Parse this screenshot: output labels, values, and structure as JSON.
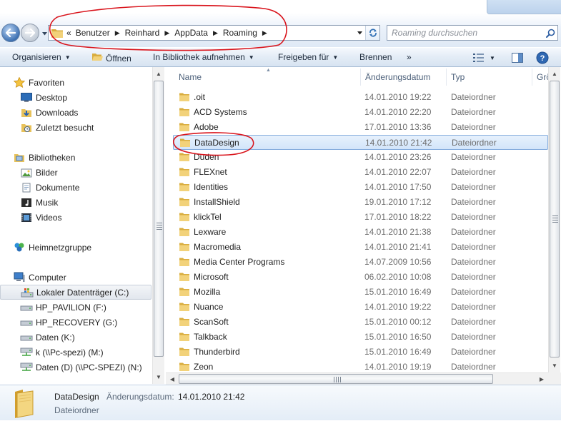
{
  "address": {
    "crumbs": [
      "Benutzer",
      "Reinhard",
      "AppData",
      "Roaming"
    ],
    "overflow_glyph": "«",
    "separator_glyph": "▶"
  },
  "search": {
    "placeholder": "Roaming durchsuchen"
  },
  "toolbar": {
    "organize": "Organisieren",
    "open": "Öffnen",
    "include_library": "In Bibliothek aufnehmen",
    "share": "Freigeben für",
    "burn": "Brennen",
    "more": "»"
  },
  "navigation": {
    "favorites": {
      "label": "Favoriten",
      "items": [
        {
          "label": "Desktop",
          "icon": "desktop-icon"
        },
        {
          "label": "Downloads",
          "icon": "downloads-folder-icon"
        },
        {
          "label": "Zuletzt besucht",
          "icon": "recent-places-icon"
        }
      ]
    },
    "libraries": {
      "label": "Bibliotheken",
      "items": [
        {
          "label": "Bilder",
          "icon": "pictures-icon"
        },
        {
          "label": "Dokumente",
          "icon": "documents-icon"
        },
        {
          "label": "Musik",
          "icon": "music-icon"
        },
        {
          "label": "Videos",
          "icon": "videos-icon"
        }
      ]
    },
    "homegroup": {
      "label": "Heimnetzgruppe"
    },
    "computer": {
      "label": "Computer",
      "items": [
        {
          "label": "Lokaler Datenträger (C:)",
          "icon": "system-drive-icon",
          "selected": true
        },
        {
          "label": "HP_PAVILION (F:)",
          "icon": "drive-icon"
        },
        {
          "label": "HP_RECOVERY (G:)",
          "icon": "drive-icon"
        },
        {
          "label": "Daten (K:)",
          "icon": "drive-icon"
        },
        {
          "label": "k (\\\\Pc-spezi) (M:)",
          "icon": "network-drive-icon"
        },
        {
          "label": "Daten (D) (\\\\PC-SPEZI) (N:)",
          "icon": "network-drive-icon"
        }
      ]
    }
  },
  "columns": {
    "name": "Name",
    "date": "Änderungsdatum",
    "type": "Typ",
    "size": "Grö"
  },
  "files": [
    {
      "name": ".oit",
      "date": "14.01.2010 19:22",
      "type": "Dateiordner"
    },
    {
      "name": "ACD Systems",
      "date": "14.01.2010 22:20",
      "type": "Dateiordner"
    },
    {
      "name": "Adobe",
      "date": "17.01.2010 13:36",
      "type": "Dateiordner"
    },
    {
      "name": "DataDesign",
      "date": "14.01.2010 21:42",
      "type": "Dateiordner",
      "selected": true
    },
    {
      "name": "Duden",
      "date": "14.01.2010 23:26",
      "type": "Dateiordner"
    },
    {
      "name": "FLEXnet",
      "date": "14.01.2010 22:07",
      "type": "Dateiordner"
    },
    {
      "name": "Identities",
      "date": "14.01.2010 17:50",
      "type": "Dateiordner"
    },
    {
      "name": "InstallShield",
      "date": "19.01.2010 17:12",
      "type": "Dateiordner"
    },
    {
      "name": "klickTel",
      "date": "17.01.2010 18:22",
      "type": "Dateiordner"
    },
    {
      "name": "Lexware",
      "date": "14.01.2010 21:38",
      "type": "Dateiordner"
    },
    {
      "name": "Macromedia",
      "date": "14.01.2010 21:41",
      "type": "Dateiordner"
    },
    {
      "name": "Media Center Programs",
      "date": "14.07.2009 10:56",
      "type": "Dateiordner"
    },
    {
      "name": "Microsoft",
      "date": "06.02.2010 10:08",
      "type": "Dateiordner"
    },
    {
      "name": "Mozilla",
      "date": "15.01.2010 16:49",
      "type": "Dateiordner"
    },
    {
      "name": "Nuance",
      "date": "14.01.2010 19:22",
      "type": "Dateiordner"
    },
    {
      "name": "ScanSoft",
      "date": "15.01.2010 00:12",
      "type": "Dateiordner"
    },
    {
      "name": "Talkback",
      "date": "15.01.2010 16:50",
      "type": "Dateiordner"
    },
    {
      "name": "Thunderbird",
      "date": "15.01.2010 16:49",
      "type": "Dateiordner"
    },
    {
      "name": "Zeon",
      "date": "14.01.2010 19:19",
      "type": "Dateiordner"
    }
  ],
  "details": {
    "name": "DataDesign",
    "date_label": "Änderungsdatum:",
    "date": "14.01.2010 21:42",
    "type": "Dateiordner"
  },
  "colors": {
    "folder": "#e8c25a",
    "selection_border": "#84acdd",
    "annotation_red": "#d9141c"
  }
}
